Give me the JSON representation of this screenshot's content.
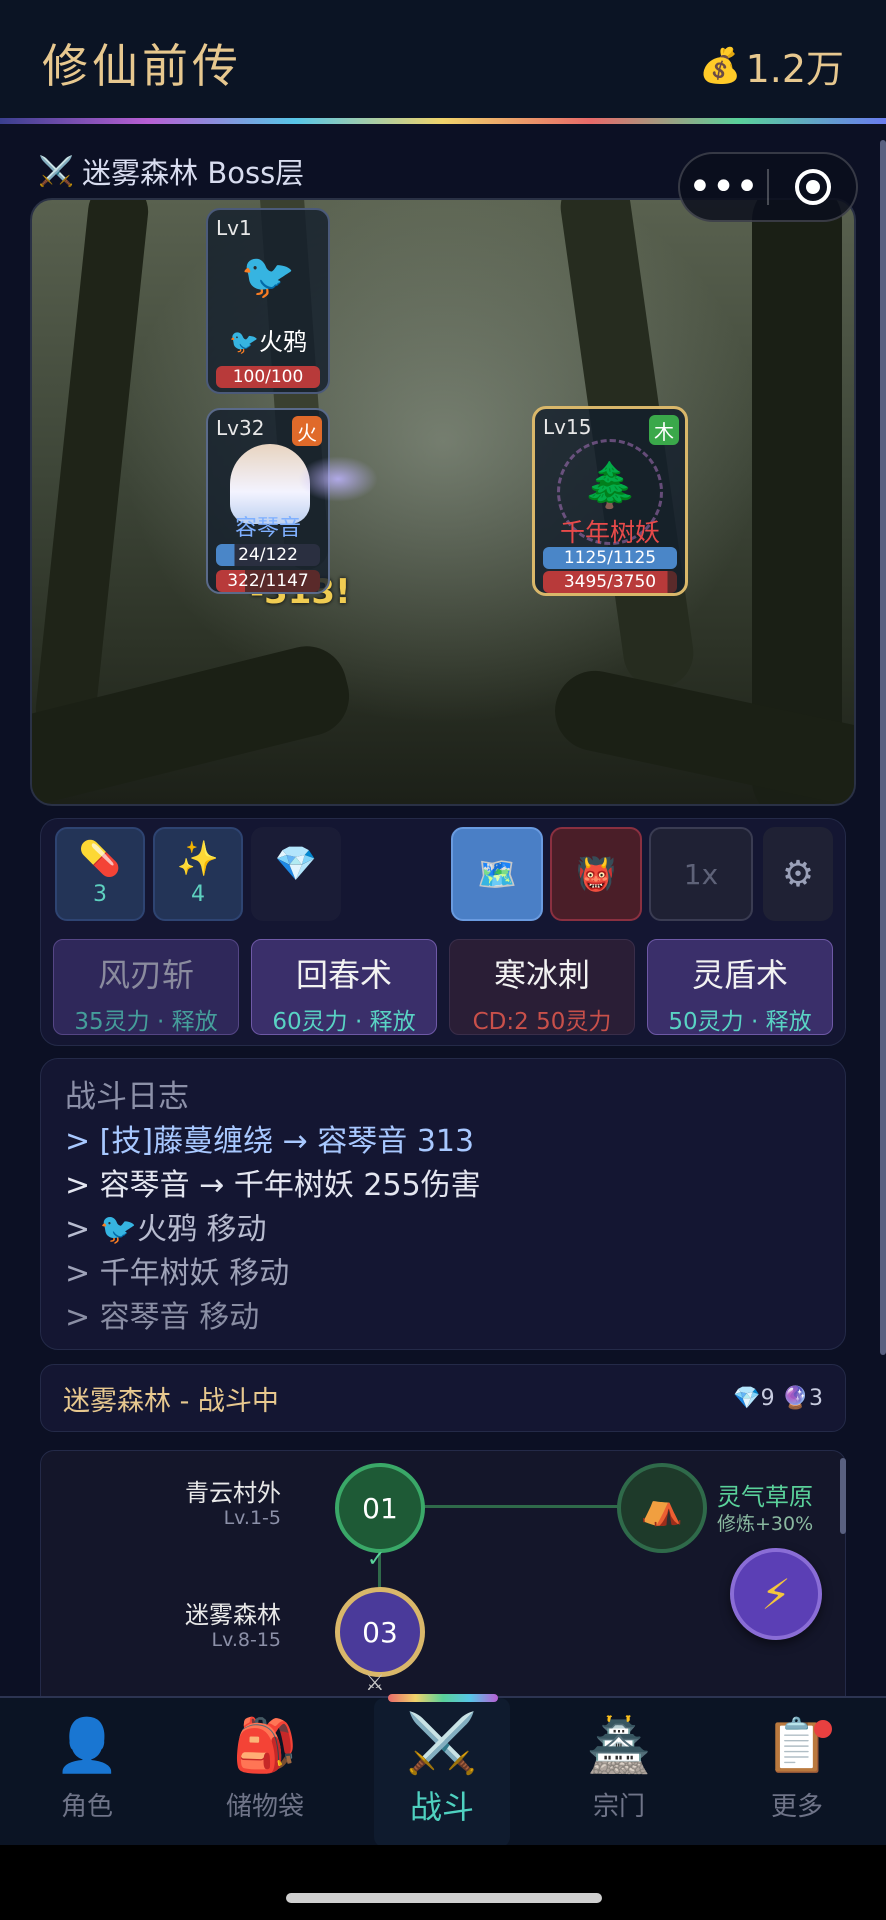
{
  "header": {
    "title": "修仙前传",
    "gold": "1.2万"
  },
  "stage_label": "迷雾森林 Boss层",
  "battle": {
    "ally_pet": {
      "level": "Lv1",
      "name": "火鸦",
      "hp": "100/100"
    },
    "damage_popup": "-313!",
    "hero": {
      "level": "Lv32",
      "element": "火",
      "name": "容琴音",
      "mp": "24/122",
      "hp": "322/1147"
    },
    "boss": {
      "level": "Lv15",
      "element": "木",
      "name": "千年树妖",
      "mp": "1125/1125",
      "hp": "3495/3750"
    }
  },
  "items": [
    {
      "icon": "pill-icon",
      "count": "3"
    },
    {
      "icon": "sparkle-icon",
      "count": "4"
    }
  ],
  "speed_label": "1x",
  "skills": [
    {
      "name": "风刃斩",
      "cost": "35灵力 · 释放",
      "state": "dim"
    },
    {
      "name": "回春术",
      "cost": "60灵力 · 释放",
      "state": "ready"
    },
    {
      "name": "寒冰刺",
      "cost": "CD:2  50灵力",
      "state": "cooldown"
    },
    {
      "name": "灵盾术",
      "cost": "50灵力 · 释放",
      "state": "ready"
    }
  ],
  "log": {
    "title": "战斗日志",
    "lines": [
      "> [技]藤蔓缠绕 → 容琴音 313",
      "> 容琴音 → 千年树妖 255伤害",
      "> 🐦火鸦 移动",
      "> 千年树妖 移动",
      "> 容琴音 移动"
    ]
  },
  "status": {
    "text": "迷雾森林 - 战斗中",
    "gems": "9",
    "orbs": "3"
  },
  "map": {
    "nodes": [
      {
        "id": "01",
        "name": "青云村外",
        "range": "Lv.1-5"
      },
      {
        "id": "03",
        "name": "迷雾森林",
        "range": "Lv.8-15"
      }
    ],
    "special": {
      "name": "灵气草原",
      "bonus": "修炼+30%"
    }
  },
  "nav": [
    {
      "label": "角色",
      "icon": "character-icon"
    },
    {
      "label": "储物袋",
      "icon": "bag-icon"
    },
    {
      "label": "战斗",
      "icon": "swords-icon"
    },
    {
      "label": "宗门",
      "icon": "pagoda-icon"
    },
    {
      "label": "更多",
      "icon": "clipboard-icon"
    }
  ],
  "colors": {
    "gold": "#e7c88f",
    "accent": "#4fd1c0",
    "hp": "#b83a3a",
    "mp": "#4a86c8",
    "skill": "#3a2f6a"
  }
}
